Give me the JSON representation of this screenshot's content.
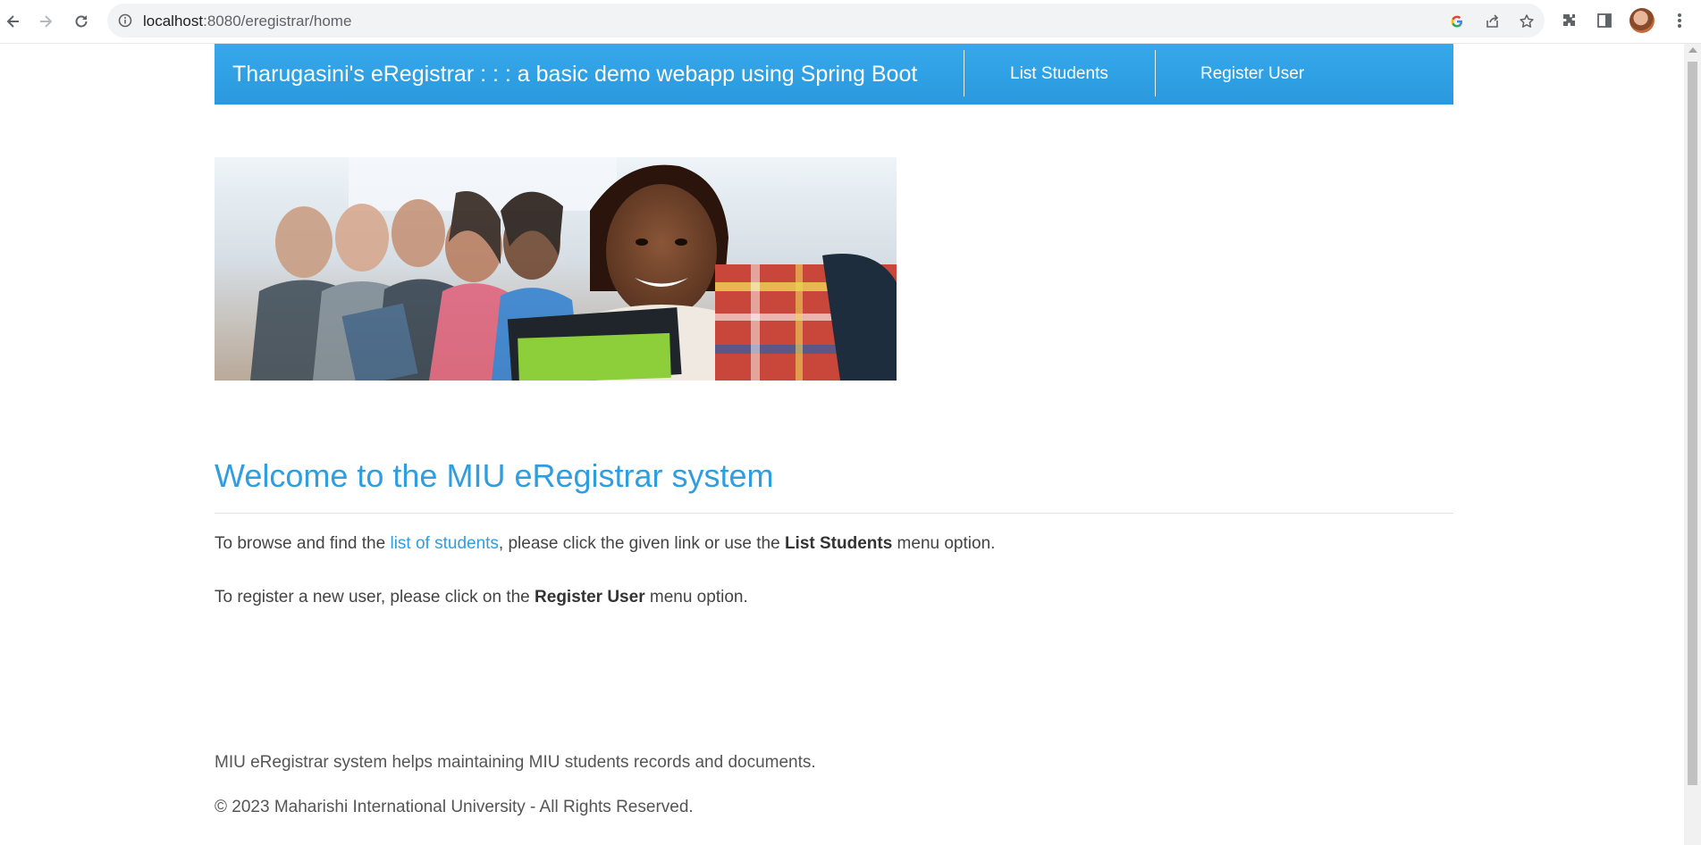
{
  "browser": {
    "url_host": "localhost",
    "url_path": ":8080/eregistrar/home"
  },
  "header": {
    "title": "Tharugasini's eRegistrar : : : a basic demo webapp using Spring Boot",
    "nav": [
      "List Students",
      "Register User"
    ]
  },
  "main": {
    "welcome": "Welcome to the MIU eRegistrar system",
    "p1_before": "To browse and find the ",
    "p1_link": "list of students",
    "p1_mid": ", please click the given link or use the ",
    "p1_bold": "List Students",
    "p1_after": " menu option.",
    "p2_before": "To register a new user, please click on the ",
    "p2_bold": "Register User",
    "p2_after": " menu option."
  },
  "footer": {
    "line1": "MIU eRegistrar system helps maintaining MIU students records and documents.",
    "line2": "© 2023 Maharishi International University - All Rights Reserved."
  }
}
